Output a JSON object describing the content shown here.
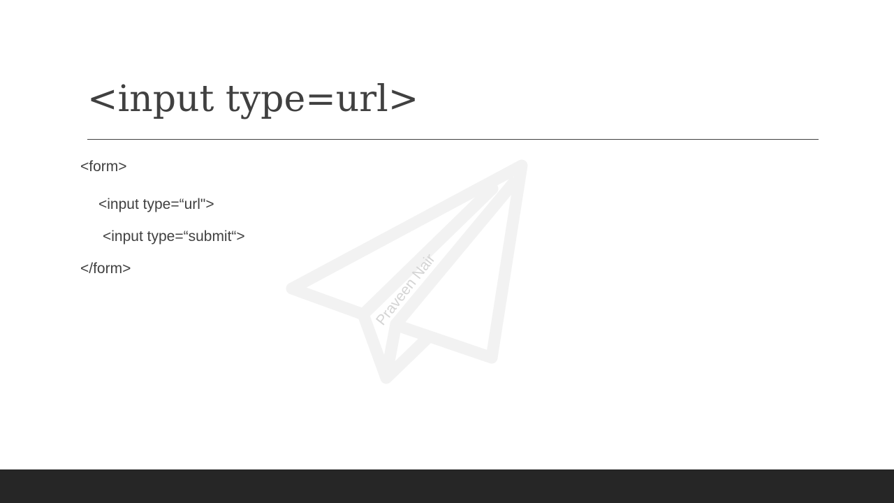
{
  "slide": {
    "title": "<input type=url>",
    "lines": [
      "<form>",
      "<input type=“url\">",
      "<input type=“submit“>",
      "</form>"
    ],
    "watermark": "Praveen Nair"
  },
  "colors": {
    "text": "#404040",
    "footer": "#262626",
    "plane": "#f2f2f2"
  }
}
